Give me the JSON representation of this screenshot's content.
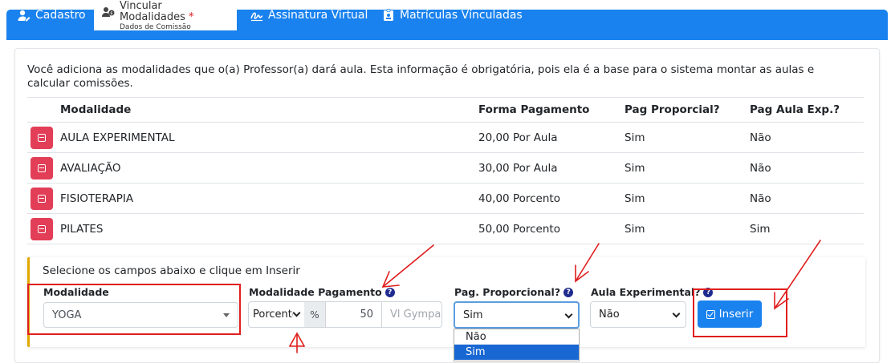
{
  "tabs": [
    {
      "label": "Cadastro",
      "icon": "user-edit-icon"
    },
    {
      "label": "Vincular Modalidades",
      "sub": "Dados de Comissão",
      "required": "*",
      "icon": "users-money-icon"
    },
    {
      "label": "Assinatura Virtual",
      "icon": "signature-icon"
    },
    {
      "label": "Matrículas Vínculadas",
      "icon": "id-badge-icon"
    }
  ],
  "intro": "Você adiciona as modalidades que o(a) Professor(a) dará aula. Esta informação é obrigatória, pois ela é a base para o sistema montar as aulas e calcular comissões.",
  "table": {
    "headers": [
      "Modalidade",
      "Forma Pagamento",
      "Pag Proporcial?",
      "Pag Aula Exp.?"
    ],
    "rows": [
      [
        "AULA EXPERIMENTAL",
        "20,00 Por Aula",
        "Sim",
        "Não"
      ],
      [
        "AVALIAÇÃO",
        "30,00 Por Aula",
        "Sim",
        "Não"
      ],
      [
        "FISIOTERAPIA",
        "40,00 Porcento",
        "Sim",
        "Não"
      ],
      [
        "PILATES",
        "50,00 Porcento",
        "Sim",
        "Sim"
      ]
    ]
  },
  "form": {
    "title": "Selecione os campos abaixo e clique em Inserir",
    "modalidade_label": "Modalidade",
    "modalidade_value": "YOGA",
    "pagamento_label": "Modalidade Pagamento",
    "pagamento_type": "Porcento",
    "pct_symbol": "%",
    "pagamento_value": "50",
    "vl_placeholder": "Vl Gympass",
    "proporcional_label": "Pag. Proporcional?",
    "proporcional_value": "Sim",
    "proporcional_options": [
      "Não",
      "Sim"
    ],
    "experimental_label": "Aula Experimental?",
    "experimental_value": "Não",
    "insert_label": "Inserir",
    "help": "?"
  },
  "colors": {
    "primary": "#1a82ee",
    "danger": "#e23e57",
    "annotation": "#e01e1e"
  }
}
